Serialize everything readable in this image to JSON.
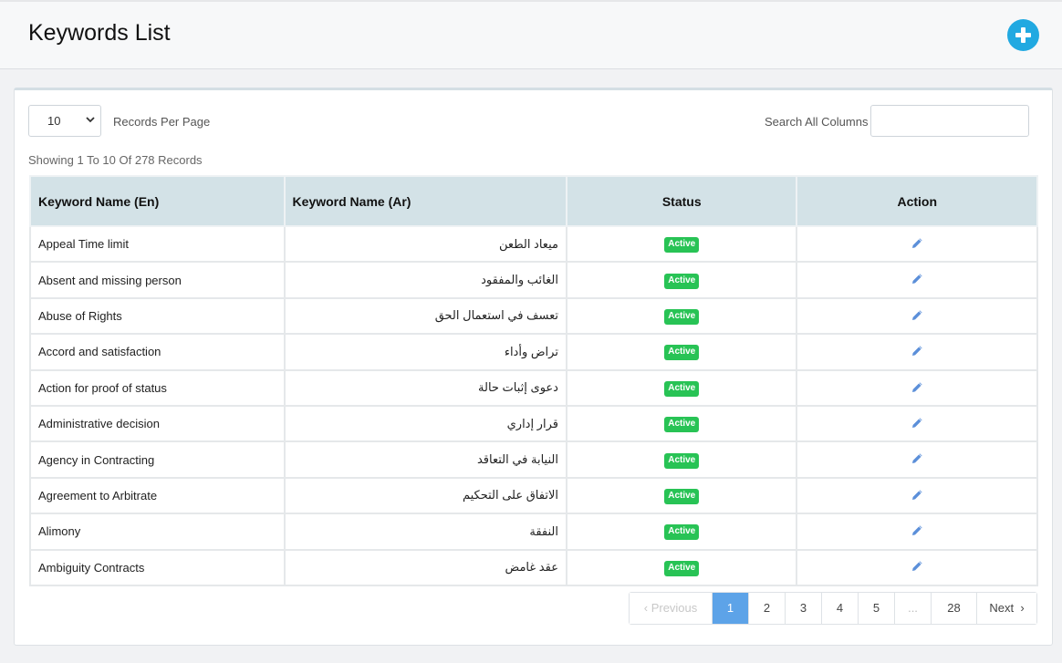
{
  "header": {
    "title": "Keywords List"
  },
  "controls": {
    "per_page_value": "10",
    "per_page_label": "Records Per Page",
    "search_label": "Search All Columns",
    "search_value": "",
    "showing": "Showing 1 To 10 Of 278 Records"
  },
  "table": {
    "columns": [
      "Keyword Name (En)",
      "Keyword Name (Ar)",
      "Status",
      "Action"
    ],
    "rows": [
      {
        "en": "Appeal Time limit",
        "ar": "ميعاد الطعن",
        "status": "Active"
      },
      {
        "en": "Absent and missing person",
        "ar": "الغائب والمفقود",
        "status": "Active"
      },
      {
        "en": "Abuse of Rights",
        "ar": "تعسف في استعمال الحق",
        "status": "Active"
      },
      {
        "en": "Accord and satisfaction",
        "ar": "تراض وأداء",
        "status": "Active"
      },
      {
        "en": "Action for proof of status",
        "ar": "دعوى إثبات حالة",
        "status": "Active"
      },
      {
        "en": "Administrative decision",
        "ar": "قرار إداري",
        "status": "Active"
      },
      {
        "en": "Agency in Contracting",
        "ar": "النيابة في التعاقد",
        "status": "Active"
      },
      {
        "en": "Agreement to Arbitrate",
        "ar": "الاتفاق على التحكيم",
        "status": "Active"
      },
      {
        "en": "Alimony",
        "ar": "النفقة",
        "status": "Active"
      },
      {
        "en": "Ambiguity Contracts",
        "ar": "عقد غامض",
        "status": "Active"
      }
    ]
  },
  "pagination": {
    "previous": "Previous",
    "pages": [
      "1",
      "2",
      "3",
      "4",
      "5"
    ],
    "ellipsis": "...",
    "last": "28",
    "next": "Next",
    "current": "1"
  },
  "icons": {
    "add": "plus-circle-icon",
    "edit": "pencil-icon"
  },
  "colors": {
    "accent": "#21a9e1",
    "active_badge": "#28c355",
    "table_header": "#d3e2e7",
    "active_page": "#5da3e8"
  }
}
